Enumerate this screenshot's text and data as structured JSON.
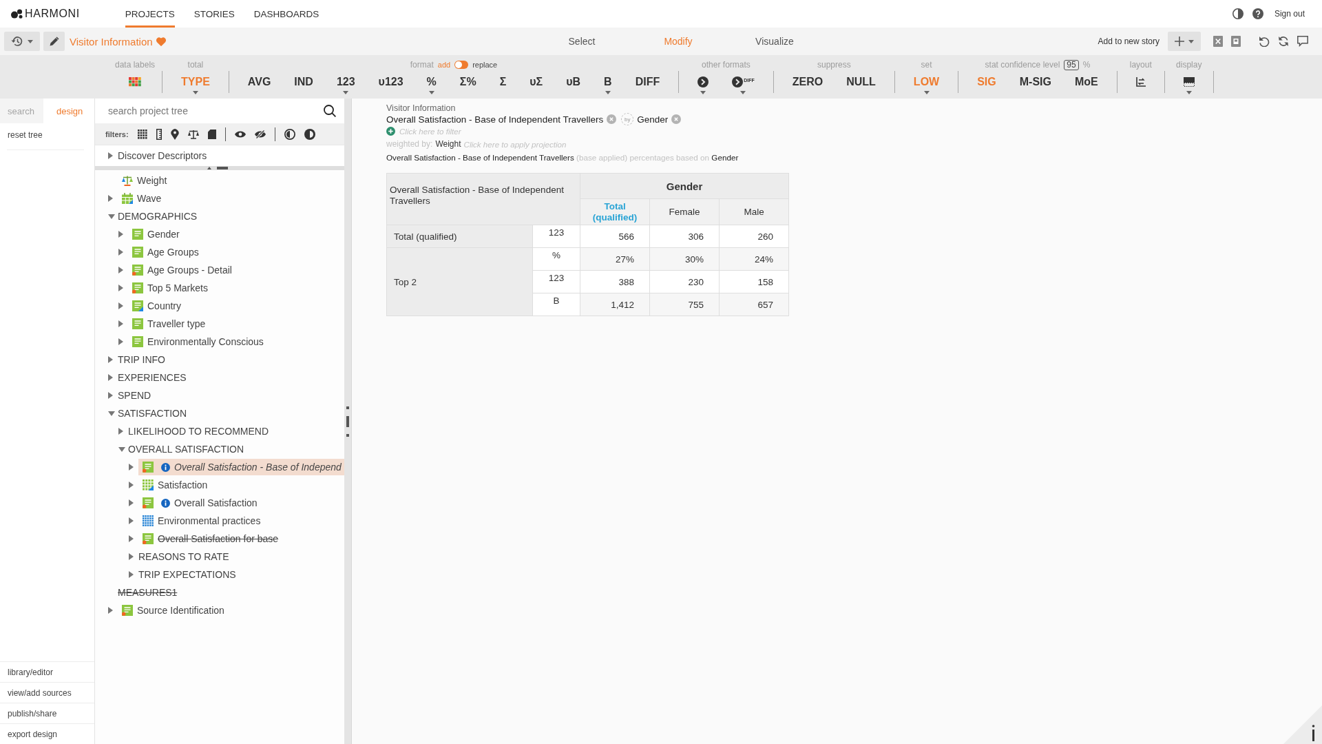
{
  "nav": {
    "logo": "HARMONI",
    "tabs": [
      {
        "label": "PROJECTS",
        "selected": true
      },
      {
        "label": "STORIES",
        "selected": false
      },
      {
        "label": "DASHBOARDS",
        "selected": false
      }
    ],
    "sign_out": "Sign out"
  },
  "project_bar": {
    "title": "Visitor Information",
    "favorite": true,
    "modes": [
      {
        "label": "Select",
        "selected": false
      },
      {
        "label": "Modify",
        "selected": true
      },
      {
        "label": "Visualize",
        "selected": false
      }
    ],
    "add_to_story": "Add to new story"
  },
  "toolbar": {
    "groups": [
      {
        "label": "data labels",
        "buttons": [
          {
            "kind": "swatch",
            "active": false,
            "dropdown": false
          }
        ]
      },
      {
        "label": "total",
        "buttons": [
          {
            "kind": "text",
            "text": "TYPE",
            "active": true,
            "dropdown": true
          }
        ]
      },
      {
        "label": "format",
        "toggle": {
          "left": "add",
          "right": "replace",
          "on": false
        },
        "buttons": [
          {
            "kind": "text",
            "text": "AVG",
            "active": false,
            "dropdown": false
          },
          {
            "kind": "text",
            "text": "IND",
            "active": false,
            "dropdown": false
          },
          {
            "kind": "text",
            "text": "123",
            "active": false,
            "dropdown": true
          },
          {
            "kind": "text",
            "text": "ᴜ123",
            "active": false,
            "dropdown": false
          },
          {
            "kind": "text",
            "text": "%",
            "active": false,
            "dropdown": true
          },
          {
            "kind": "text",
            "text": "Σ%",
            "active": false,
            "dropdown": false
          },
          {
            "kind": "text",
            "text": "Σ",
            "active": false,
            "dropdown": false
          },
          {
            "kind": "text",
            "text": "ᴜΣ",
            "active": false,
            "dropdown": false
          },
          {
            "kind": "text",
            "text": "ᴜB",
            "active": false,
            "dropdown": false
          },
          {
            "kind": "text",
            "text": "B",
            "active": false,
            "dropdown": true
          },
          {
            "kind": "text",
            "text": "DIFF",
            "active": false,
            "dropdown": false
          }
        ]
      },
      {
        "label": "other formats",
        "buttons": [
          {
            "kind": "pie",
            "active": false,
            "dropdown": true
          },
          {
            "kind": "pie",
            "text": "DIFF",
            "active": false,
            "dropdown": true
          }
        ]
      },
      {
        "label": "suppress",
        "buttons": [
          {
            "kind": "text",
            "text": "ZERO",
            "active": false,
            "dropdown": false
          },
          {
            "kind": "text",
            "text": "NULL",
            "active": false,
            "dropdown": false
          }
        ]
      },
      {
        "label": "set",
        "buttons": [
          {
            "kind": "text",
            "text": "LOW",
            "active": true,
            "dropdown": true
          }
        ]
      },
      {
        "label": "stat confidence level",
        "confidence": "95",
        "unit": "%",
        "buttons": [
          {
            "kind": "text",
            "text": "SIG",
            "active": true,
            "dropdown": false
          },
          {
            "kind": "text",
            "text": "M-SIG",
            "active": false,
            "dropdown": false
          },
          {
            "kind": "text",
            "text": "MoE",
            "active": false,
            "dropdown": false
          }
        ]
      },
      {
        "label": "layout",
        "buttons": [
          {
            "kind": "layout",
            "active": false,
            "dropdown": false
          }
        ]
      },
      {
        "label": "display",
        "buttons": [
          {
            "kind": "display",
            "active": false,
            "dropdown": true
          }
        ]
      }
    ]
  },
  "sidebar": {
    "tabs": [
      {
        "label": "search",
        "selected": false
      },
      {
        "label": "design",
        "selected": true
      }
    ],
    "reset": "reset tree",
    "links": [
      "library/editor",
      "view/add sources",
      "publish/share",
      "export design"
    ]
  },
  "tree": {
    "search_placeholder": "search project tree",
    "filters_label": "filters:",
    "pinned": {
      "label": "Discover Descriptors",
      "expanded": false
    },
    "nodes": [
      {
        "label": "Weight",
        "kind": "weight",
        "selected": false,
        "struck": false,
        "info": false
      },
      {
        "label": "Wave",
        "kind": "wave",
        "expanded": false,
        "selected": false,
        "struck": false,
        "info": false
      },
      {
        "label": "DEMOGRAPHICS",
        "kind": "folder",
        "expanded": true,
        "selected": false,
        "struck": false,
        "info": false,
        "children": [
          {
            "label": "Gender",
            "kind": "variable",
            "expanded": false,
            "selected": false,
            "struck": false,
            "info": false
          },
          {
            "label": "Age Groups",
            "kind": "variable",
            "expanded": false,
            "selected": false,
            "struck": false,
            "info": false
          },
          {
            "label": "Age Groups - Detail",
            "kind": "derived",
            "expanded": false,
            "selected": false,
            "struck": false,
            "info": false
          },
          {
            "label": "Top 5 Markets",
            "kind": "derived",
            "expanded": false,
            "selected": false,
            "struck": false,
            "info": false
          },
          {
            "label": "Country",
            "kind": "geo",
            "expanded": false,
            "selected": false,
            "struck": false,
            "info": false
          },
          {
            "label": "Traveller type",
            "kind": "variable",
            "expanded": false,
            "selected": false,
            "struck": false,
            "info": false
          },
          {
            "label": "Environmentally Conscious",
            "kind": "variable",
            "expanded": false,
            "selected": false,
            "struck": false,
            "info": false
          }
        ]
      },
      {
        "label": "TRIP INFO",
        "kind": "folder",
        "expanded": false,
        "selected": false,
        "struck": false,
        "info": false
      },
      {
        "label": "EXPERIENCES",
        "kind": "folder",
        "expanded": false,
        "selected": false,
        "struck": false,
        "info": false
      },
      {
        "label": "SPEND",
        "kind": "folder",
        "expanded": false,
        "selected": false,
        "struck": false,
        "info": false
      },
      {
        "label": "SATISFACTION",
        "kind": "folder",
        "expanded": true,
        "selected": false,
        "struck": false,
        "info": false,
        "children": [
          {
            "label": "LIKELIHOOD TO RECOMMEND",
            "kind": "folder",
            "expanded": false,
            "selected": false,
            "struck": false,
            "info": false
          },
          {
            "label": "OVERALL SATISFACTION",
            "kind": "folder",
            "expanded": true,
            "selected": false,
            "struck": false,
            "info": false,
            "children": [
              {
                "label": "Overall Satisfaction - Base of Independ",
                "kind": "derived",
                "expanded": false,
                "selected": true,
                "struck": false,
                "info": true
              },
              {
                "label": "Satisfaction",
                "kind": "grid",
                "expanded": false,
                "selected": false,
                "struck": false,
                "info": false
              },
              {
                "label": "Overall Satisfaction",
                "kind": "derived",
                "expanded": false,
                "selected": false,
                "struck": false,
                "info": true
              },
              {
                "label": "Environmental practices",
                "kind": "matrix",
                "expanded": false,
                "selected": false,
                "struck": false,
                "info": false
              },
              {
                "label": "Overall Satisfaction for base",
                "kind": "derived",
                "expanded": false,
                "selected": false,
                "struck": true,
                "info": false
              },
              {
                "label": "REASONS TO RATE",
                "kind": "folder",
                "expanded": false,
                "selected": false,
                "struck": false,
                "info": false
              },
              {
                "label": "TRIP EXPECTATIONS",
                "kind": "folder",
                "expanded": false,
                "selected": false,
                "struck": false,
                "info": false
              }
            ]
          }
        ]
      },
      {
        "label": "MEASURES1",
        "kind": "folder",
        "selected": false,
        "struck": true,
        "info": false
      },
      {
        "label": "Source Identification",
        "kind": "derived",
        "expanded": false,
        "selected": false,
        "struck": false,
        "info": false
      }
    ]
  },
  "crosstab": {
    "project": "Visitor Information",
    "row_variable": "Overall Satisfaction - Base of Independent Travellers",
    "by": "by",
    "column_variable": "Gender",
    "filter_link": "Click here to filter",
    "weight_label": "weighted by:",
    "weight": "Weight",
    "projection_link": "Click here to apply projection",
    "base_note": [
      {
        "kind": "value",
        "text": "Overall Satisfaction - Base of Independent Travellers"
      },
      {
        "kind": "note",
        "text": "(base applied) percentages based on"
      },
      {
        "kind": "value",
        "text": "Gender"
      }
    ],
    "table": {
      "corner": "Overall Satisfaction - Base of Independent Travellers",
      "column_variable": "Gender",
      "columns": [
        {
          "label": "Total (qualified)",
          "kind": "total"
        },
        {
          "label": "Female",
          "kind": "category"
        },
        {
          "label": "Male",
          "kind": "category"
        }
      ],
      "rows": [
        {
          "label": "Total (qualified)",
          "stats": [
            {
              "stat": "123",
              "values": [
                "566",
                "306",
                "260"
              ]
            }
          ]
        },
        {
          "label": "Top 2",
          "stats": [
            {
              "stat": "%",
              "values": [
                "27%",
                "30%",
                "24%"
              ]
            },
            {
              "stat": "123",
              "values": [
                "388",
                "230",
                "158"
              ]
            },
            {
              "stat": "B",
              "values": [
                "1,412",
                "755",
                "657"
              ]
            }
          ]
        }
      ]
    }
  }
}
